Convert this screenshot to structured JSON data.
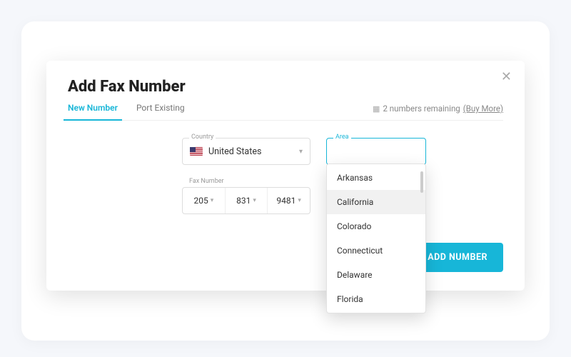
{
  "modal": {
    "title": "Add Fax Number",
    "tabs": {
      "new": "New Number",
      "port": "Port Existing"
    },
    "remaining": {
      "count_text": "2 numbers remaining",
      "buy_more": "(Buy More)"
    }
  },
  "fields": {
    "country": {
      "label": "Country",
      "value": "United States"
    },
    "area": {
      "label": "Area"
    },
    "fax": {
      "label": "Fax Number",
      "seg1": "205",
      "seg2": "831",
      "seg3": "9481"
    }
  },
  "area_options": {
    "o0": "Arkansas",
    "o1": "California",
    "o2": "Colorado",
    "o3": "Connecticut",
    "o4": "Delaware",
    "o5": "Florida"
  },
  "buttons": {
    "add": "ADD NUMBER"
  }
}
